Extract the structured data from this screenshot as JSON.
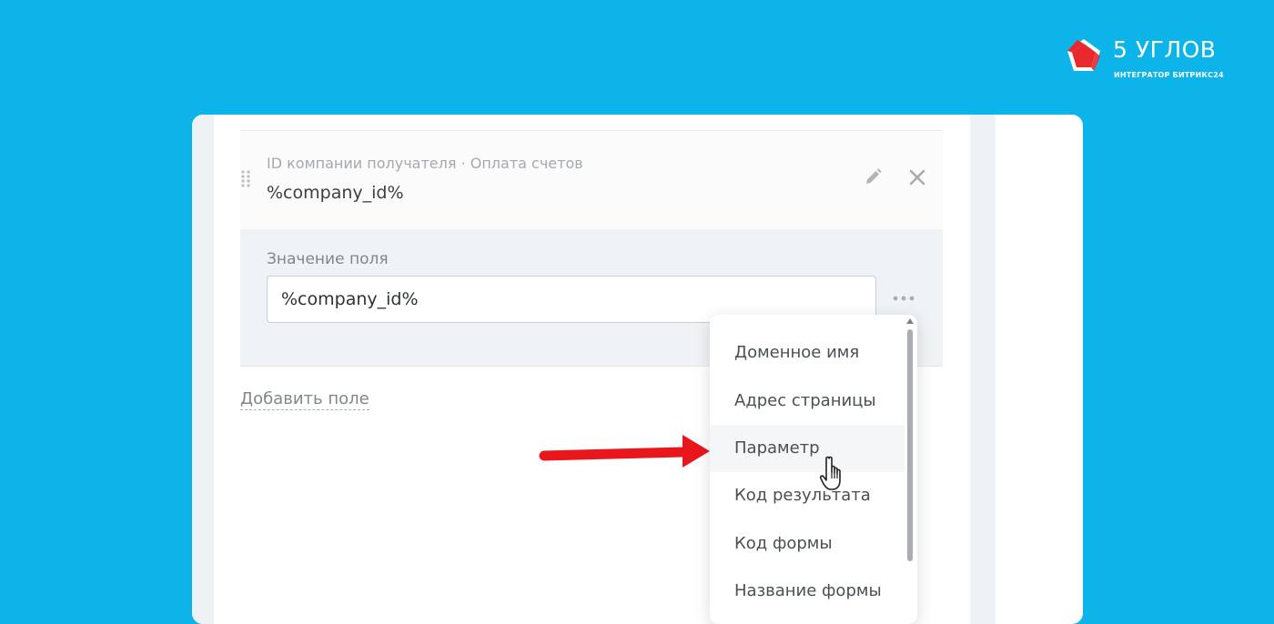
{
  "logo": {
    "title": "5 УГЛОВ",
    "subtitle": "ИНТЕГРАТОР БИТРИКС24",
    "brand_red": "#e8292e"
  },
  "colors": {
    "background": "#0db4e9",
    "panel": "#ffffff",
    "annotation_arrow": "#e9171b"
  },
  "field": {
    "caption": "ID компании получателя · Оплата счетов",
    "code": "%company_id%",
    "icons": {
      "drag": "drag-handle-icon",
      "edit": "pencil-icon",
      "remove": "close-icon"
    }
  },
  "value": {
    "label": "Значение поля",
    "input_value": "%company_id%",
    "more_icon": "more-dots-icon"
  },
  "add_field": {
    "label": "Добавить поле"
  },
  "dropdown": {
    "items": [
      {
        "label": "Доменное имя"
      },
      {
        "label": "Адрес страницы"
      },
      {
        "label": "Параметр"
      },
      {
        "label": "Код результата"
      },
      {
        "label": "Код формы"
      },
      {
        "label": "Название формы"
      }
    ],
    "active_item": "Параметр"
  }
}
